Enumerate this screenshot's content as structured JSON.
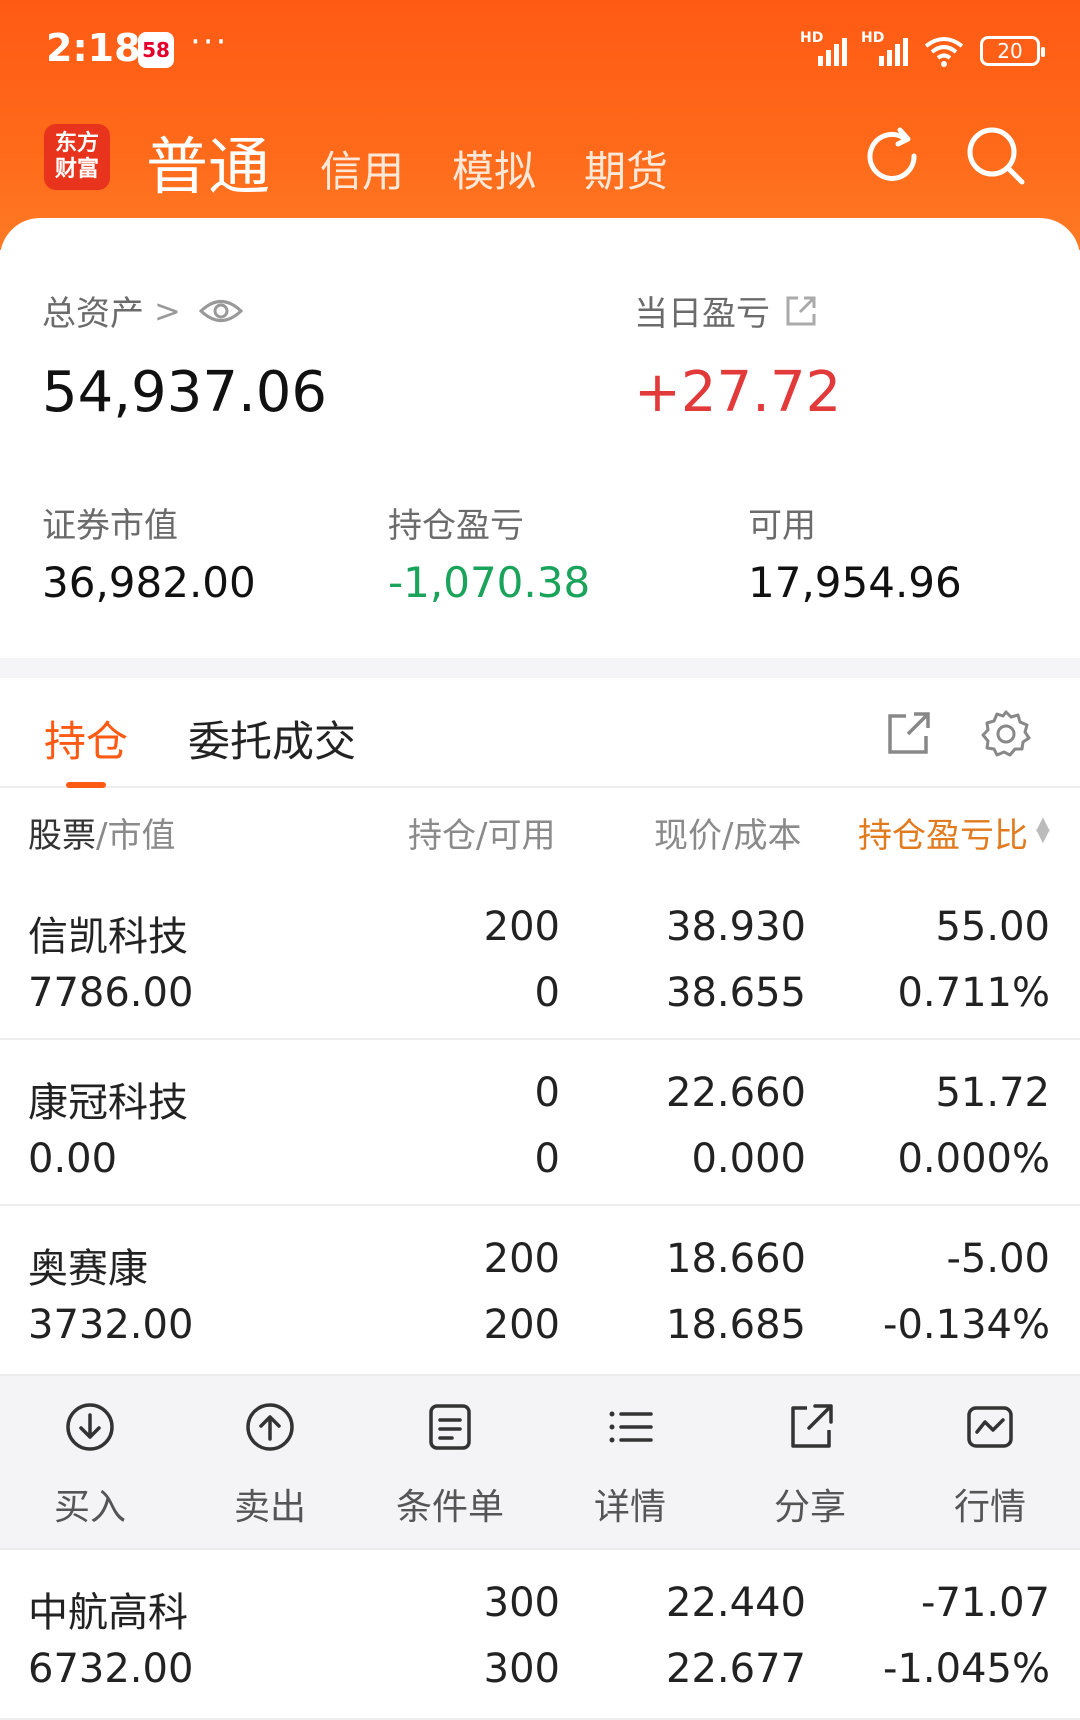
{
  "status_bar": {
    "time": "2:18",
    "app_badge": "58",
    "dots": "···",
    "battery": "20"
  },
  "nav": {
    "logo_line1": "东方",
    "logo_line2": "财富",
    "tabs": [
      "普通",
      "信用",
      "模拟",
      "期货"
    ],
    "refresh_icon": "refresh-icon",
    "search_icon": "search-icon"
  },
  "summary": {
    "total_assets_label": "总资产",
    "total_assets_arrow": ">",
    "total_assets": "54,937.06",
    "daily_pl_label": "当日盈亏",
    "daily_pl": "+27.72",
    "market_value_label": "证券市值",
    "market_value": "36,982.00",
    "position_pl_label": "持仓盈亏",
    "position_pl": "-1,070.38",
    "available_label": "可用",
    "available": "17,954.96"
  },
  "section_tabs": [
    "持仓",
    "委托成交"
  ],
  "columns": {
    "stock": "股票",
    "mv": "/市值",
    "hold": "持仓/可用",
    "price": "现价/成本",
    "plratio": "持仓盈亏比"
  },
  "positions": [
    {
      "name": "信凯科技",
      "market_value": "7786.00",
      "hold": "200",
      "avail": "0",
      "price": "38.930",
      "cost": "38.655",
      "pl": "55.00",
      "pl_pct": "0.711%",
      "dir": "up"
    },
    {
      "name": "康冠科技",
      "market_value": "0.00",
      "hold": "0",
      "avail": "0",
      "price": "22.660",
      "cost": "0.000",
      "pl": "51.72",
      "pl_pct": "0.000%",
      "dir": "up"
    },
    {
      "name": "奥赛康",
      "market_value": "3732.00",
      "hold": "200",
      "avail": "200",
      "price": "18.660",
      "cost": "18.685",
      "pl": "-5.00",
      "pl_pct": "-0.134%",
      "dir": "down"
    },
    {
      "name": "中航高科",
      "market_value": "6732.00",
      "hold": "300",
      "avail": "300",
      "price": "22.440",
      "cost": "22.677",
      "pl": "-71.07",
      "pl_pct": "-1.045%",
      "dir": "down"
    }
  ],
  "actions": [
    {
      "label": "买入",
      "icon": "buy-icon"
    },
    {
      "label": "卖出",
      "icon": "sell-icon"
    },
    {
      "label": "条件单",
      "icon": "condition-order-icon"
    },
    {
      "label": "详情",
      "icon": "details-icon"
    },
    {
      "label": "分享",
      "icon": "share-icon"
    },
    {
      "label": "行情",
      "icon": "quote-icon"
    }
  ],
  "colors": {
    "brand_orange": "#ff5a14",
    "up_red": "#e23a3a",
    "down_green": "#1aa35a"
  }
}
